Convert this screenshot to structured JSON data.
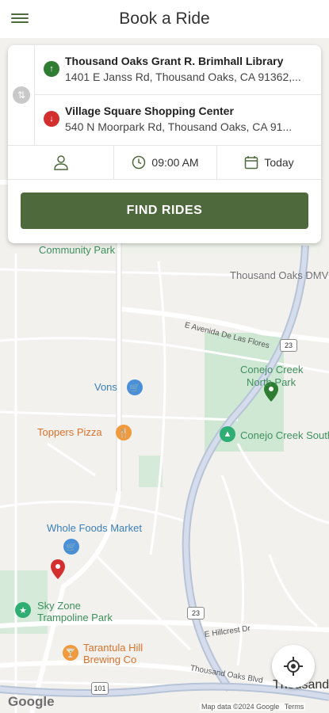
{
  "header": {
    "title": "Book a Ride",
    "menu_icon": "hamburger-menu-icon"
  },
  "booking": {
    "origin": {
      "name": "Thousand Oaks Grant R. Brimhall Library",
      "address": "1401 E Janss Rd, Thousand Oaks, CA 91362,..."
    },
    "destination": {
      "name": "Village Square Shopping Center",
      "address": "540 N Moorpark Rd, Thousand Oaks, CA 91..."
    },
    "time": "09:00 AM",
    "date": "Today",
    "find_button": "FIND RIDES",
    "accent_color": "#4e6a3c"
  },
  "map": {
    "places": {
      "community_park": "Community Park",
      "thousand_oaks_dmv": "Thousand Oaks DMV",
      "vons": "Vons",
      "toppers_pizza": "Toppers Pizza",
      "conejo_creek_north_park_1": "Conejo Creek",
      "conejo_creek_north_park_2": "North Park",
      "conejo_creek_south": "Conejo Creek South",
      "whole_foods": "Whole Foods Market",
      "sky_zone_1": "Sky Zone",
      "sky_zone_2": "Trampoline Park",
      "tarantula_hill_1": "Tarantula Hill",
      "tarantula_hill_2": "Brewing Co",
      "thousand_oaks_city": "Thousand"
    },
    "streets": {
      "avenida": "E Avenida De Las Flores",
      "hillcrest": "E Hillcrest Dr",
      "thousand_oaks_blvd": "Thousand Oaks Blvd"
    },
    "shields": {
      "hwy23_north": "23",
      "hwy23_south": "23",
      "hwy101": "101"
    },
    "attribution": "Map data ©2024 Google",
    "terms": "Terms",
    "google_logo": "Google"
  }
}
